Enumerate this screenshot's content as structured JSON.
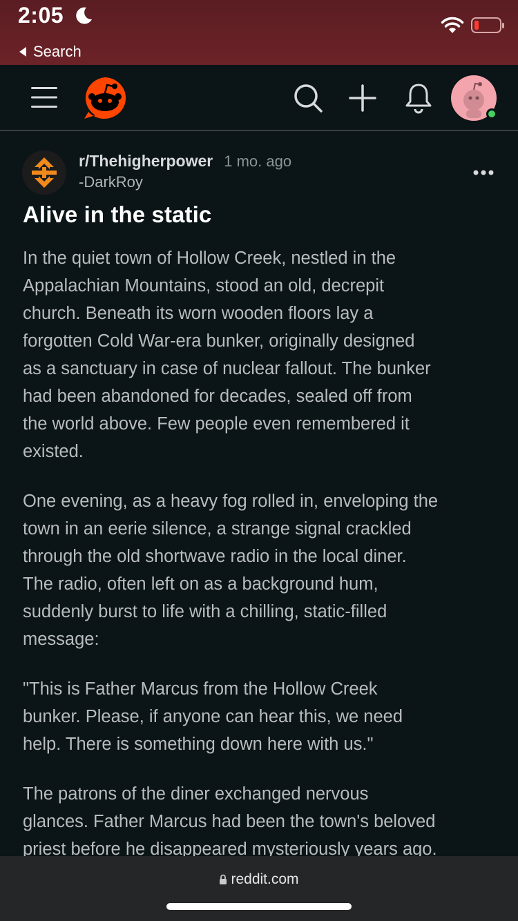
{
  "status_bar": {
    "time": "2:05",
    "back_label": "Search",
    "bg_color": "#5a1d22"
  },
  "header": {
    "icons": [
      "menu-icon",
      "reddit-logo",
      "search-icon",
      "plus-icon",
      "bell-icon",
      "avatar"
    ],
    "online_status_color": "#46d160"
  },
  "post": {
    "subreddit": "r/Thehigherpower",
    "time_ago": "1 mo. ago",
    "author": "-DarkRoy",
    "title": "Alive in the static",
    "paragraphs": [
      {
        "lines": [
          "In the quiet town of Hollow Creek, nestled in the",
          "Appalachian Mountains, stood an old, decrepit",
          "church. Beneath its worn wooden floors lay a",
          "forgotten Cold War-era bunker, originally designed",
          "as a sanctuary in case of nuclear fallout. The bunker",
          "had been abandoned for decades, sealed off from",
          "the world above. Few people even remembered it",
          "existed."
        ]
      },
      {
        "lines": [
          "One evening, as a heavy fog rolled in, enveloping the",
          "town in an eerie silence, a strange signal crackled",
          "through the old shortwave radio in the local diner.",
          "The radio, often left on as a background hum,",
          "suddenly burst to life with a chilling, static-filled",
          "message:"
        ]
      },
      {
        "lines": [
          "\"This is Father Marcus from the Hollow Creek",
          "bunker. Please, if anyone can hear this, we need",
          "help. There is something down here with us.\""
        ]
      },
      {
        "lines": [
          "The patrons of the diner exchanged nervous",
          "glances. Father Marcus had been the town's beloved",
          "priest before he disappeared mysteriously years ago."
        ]
      }
    ]
  },
  "browser_bar": {
    "url": "reddit.com"
  },
  "colors": {
    "background": "#0b1416",
    "text_primary": "#ffffff",
    "text_body": "#b8bcbe",
    "reddit_orange": "#ff4500"
  }
}
